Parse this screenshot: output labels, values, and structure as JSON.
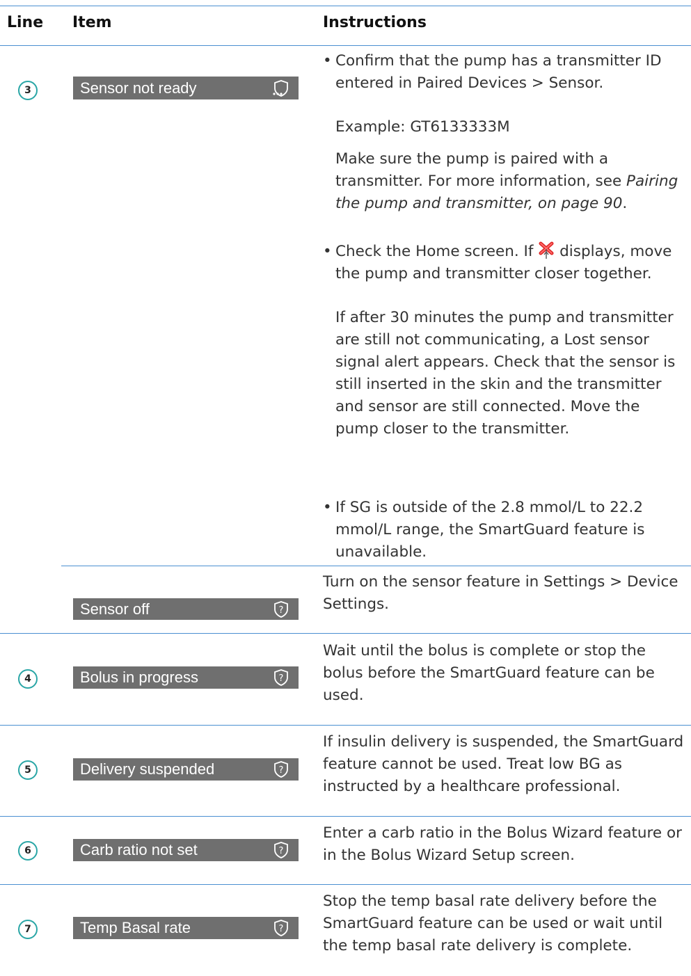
{
  "header": {
    "line": "Line",
    "item": "Item",
    "instructions": "Instructions"
  },
  "rows": [
    {
      "line": "3",
      "item": "Sensor not ready",
      "icon": "sensor-not-ready-shield-icon",
      "p1": "Confirm that the pump has a transmitter ID entered in Paired Devices > Sensor.",
      "p2": "Example: GT6133333M",
      "p3a": "Make sure the pump is paired with a transmitter. For more information, see ",
      "p3b": "Pairing the pump and transmitter, on page 90",
      "p3c": ".",
      "p4a": "Check the Home screen. If ",
      "p4b": " displays, move the pump and transmitter closer together.",
      "p4_icon": "lost-signal-icon",
      "p5": "If after 30 minutes the pump and transmitter are still not communicating, a Lost sensor signal alert appears. Check that the sensor is still inserted in the skin and the transmitter and sensor are still connected. Move the pump closer to the transmitter.",
      "p6": "If SG is outside of the 2.8 mmol/L to 22.2 mmol/L range, the SmartGuard feature is unavailable."
    },
    {
      "line": "",
      "item": "Sensor off",
      "icon": "question-shield-icon",
      "text": "Turn on the sensor feature in Settings > Device Settings."
    },
    {
      "line": "4",
      "item": "Bolus in progress",
      "icon": "question-shield-icon",
      "text": "Wait until the bolus is complete or stop the bolus before the SmartGuard feature can be used."
    },
    {
      "line": "5",
      "item": "Delivery suspended",
      "icon": "question-shield-icon",
      "text": "If insulin delivery is suspended, the SmartGuard feature cannot be used. Treat low BG as instructed by a healthcare professional."
    },
    {
      "line": "6",
      "item": "Carb ratio not set",
      "icon": "question-shield-icon",
      "text": "Enter a carb ratio in the Bolus Wizard feature or in the Bolus Wizard Setup screen."
    },
    {
      "line": "7",
      "item": "Temp Basal rate",
      "icon": "question-shield-icon",
      "text": "Stop the temp basal rate delivery before the SmartGuard feature can be used or wait until the temp basal rate delivery is complete."
    }
  ],
  "colors": {
    "rule": "#4a8fd1",
    "circle": "#2aa6a6",
    "bar": "#6f6f6f"
  }
}
